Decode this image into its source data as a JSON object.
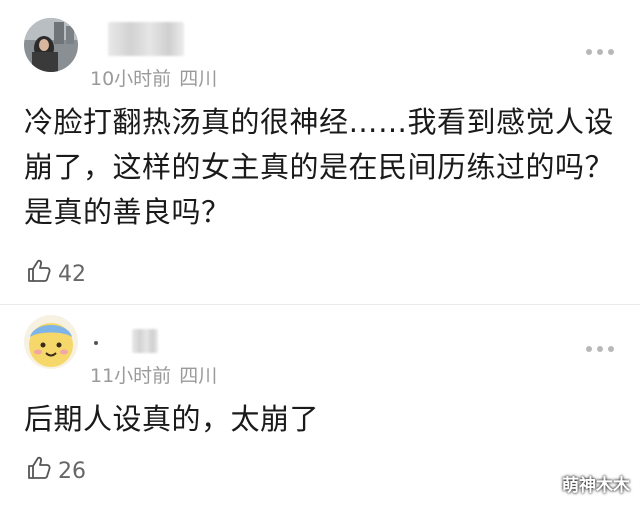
{
  "comments": [
    {
      "time": "10小时前",
      "location": "四川",
      "text": "冷脸打翻热汤真的很神经……我看到感觉人设崩了，这样的女主真的是在民间历练过的吗？是真的善良吗？",
      "likes": "42"
    },
    {
      "time": "11小时前",
      "location": "四川",
      "text": "后期人设真的，太崩了",
      "likes": "26"
    }
  ],
  "watermark": "萌神木木",
  "icons": {
    "more": "more-dots-icon",
    "like": "thumbs-up-icon"
  },
  "colors": {
    "meta": "#9a9a9a",
    "text": "#1a1a1a"
  }
}
